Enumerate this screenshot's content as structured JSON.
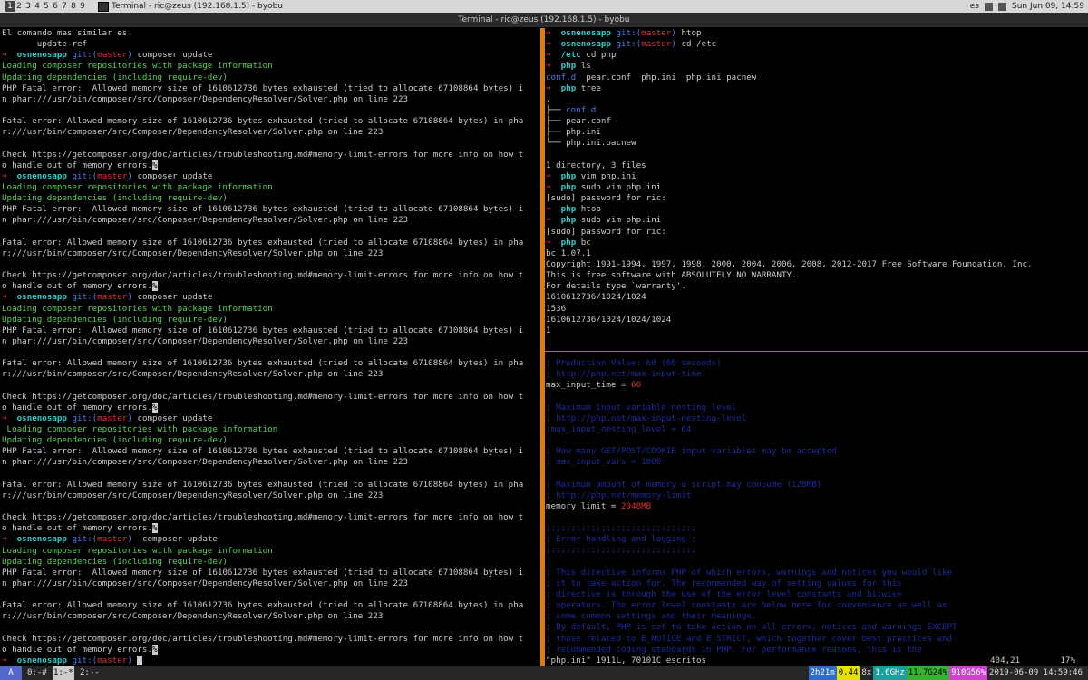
{
  "desktop": {
    "workspaces": [
      "1",
      "2",
      "3",
      "4",
      "5",
      "6",
      "7",
      "8",
      "9"
    ],
    "active_workspace": "1",
    "task_label": "Terminal - ric@zeus (192.168.1.5) - byobu",
    "tray_lang": "es",
    "tray_datetime": "Sun Jun 09, 14:59"
  },
  "window": {
    "title": "Terminal - ric@zeus (192.168.1.5) - byobu"
  },
  "left_pane": {
    "lines": [
      "El comando mas similar es",
      "       update-ref",
      "➜  osnenosapp git:(master) composer update",
      "Loading composer repositories with package information",
      "Updating dependencies (including require-dev)",
      "PHP Fatal error:  Allowed memory size of 1610612736 bytes exhausted (tried to allocate 67108864 bytes) i",
      "n phar:///usr/bin/composer/src/Composer/DependencyResolver/Solver.php on line 223",
      "",
      "Fatal error: Allowed memory size of 1610612736 bytes exhausted (tried to allocate 67108864 bytes) in pha",
      "r:///usr/bin/composer/src/Composer/DependencyResolver/Solver.php on line 223",
      "",
      "Check https://getcomposer.org/doc/articles/troubleshooting.md#memory-limit-errors for more info on how t",
      "o handle out of memory errors.%",
      "➜  osnenosapp git:(master) composer update",
      "Loading composer repositories with package information",
      "Updating dependencies (including require-dev)",
      "PHP Fatal error:  Allowed memory size of 1610612736 bytes exhausted (tried to allocate 67108864 bytes) i",
      "n phar:///usr/bin/composer/src/Composer/DependencyResolver/Solver.php on line 223",
      "",
      "Fatal error: Allowed memory size of 1610612736 bytes exhausted (tried to allocate 67108864 bytes) in pha",
      "r:///usr/bin/composer/src/Composer/DependencyResolver/Solver.php on line 223",
      "",
      "Check https://getcomposer.org/doc/articles/troubleshooting.md#memory-limit-errors for more info on how t",
      "o handle out of memory errors.%",
      "➜  osnenosapp git:(master) composer update",
      "Loading composer repositories with package information",
      "Updating dependencies (including require-dev)",
      "PHP Fatal error:  Allowed memory size of 1610612736 bytes exhausted (tried to allocate 67108864 bytes) i",
      "n phar:///usr/bin/composer/src/Composer/DependencyResolver/Solver.php on line 223",
      "",
      "Fatal error: Allowed memory size of 1610612736 bytes exhausted (tried to allocate 67108864 bytes) in pha",
      "r:///usr/bin/composer/src/Composer/DependencyResolver/Solver.php on line 223",
      "",
      "Check https://getcomposer.org/doc/articles/troubleshooting.md#memory-limit-errors for more info on how t",
      "o handle out of memory errors.%",
      "➜  osnenosapp git:(master) composer update",
      " Loading composer repositories with package information",
      "Updating dependencies (including require-dev)",
      "PHP Fatal error:  Allowed memory size of 1610612736 bytes exhausted (tried to allocate 67108864 bytes) i",
      "n phar:///usr/bin/composer/src/Composer/DependencyResolver/Solver.php on line 223",
      "",
      "Fatal error: Allowed memory size of 1610612736 bytes exhausted (tried to allocate 67108864 bytes) in pha",
      "r:///usr/bin/composer/src/Composer/DependencyResolver/Solver.php on line 223",
      "",
      "Check https://getcomposer.org/doc/articles/troubleshooting.md#memory-limit-errors for more info on how t",
      "o handle out of memory errors.%",
      "➜  osnenosapp git:(master)  composer update",
      "Loading composer repositories with package information",
      "Updating dependencies (including require-dev)",
      "PHP Fatal error:  Allowed memory size of 1610612736 bytes exhausted (tried to allocate 67108864 bytes) i",
      "n phar:///usr/bin/composer/src/Composer/DependencyResolver/Solver.php on line 223",
      "",
      "Fatal error: Allowed memory size of 1610612736 bytes exhausted (tried to allocate 67108864 bytes) in pha",
      "r:///usr/bin/composer/src/Composer/DependencyResolver/Solver.php on line 223",
      "",
      "Check https://getcomposer.org/doc/articles/troubleshooting.md#memory-limit-errors for more info on how t",
      "o handle out of memory errors.%",
      "➜  osnenosapp git:(master) "
    ]
  },
  "right_pane": {
    "lines": [
      "➜  osnenosapp git:(master) htop",
      "➜  osnenosapp git:(master) cd /etc",
      "➜  /etc cd php",
      "➜  php ls",
      "conf.d  pear.conf  php.ini  php.ini.pacnew",
      "➜  php tree",
      ".",
      "├── conf.d",
      "├── pear.conf",
      "├── php.ini",
      "└── php.ini.pacnew",
      "",
      "1 directory, 3 files",
      "➜  php vim php.ini",
      "➜  php sudo vim php.ini",
      "[sudo] password for ric:",
      "➜  php htop",
      "➜  php sudo vim php.ini",
      "[sudo] password for ric:",
      "➜  php bc",
      "bc 1.07.1",
      "Copyright 1991-1994, 1997, 1998, 2000, 2004, 2006, 2008, 2012-2017 Free Software Foundation, Inc.",
      "This is free software with ABSOLUTELY NO WARRANTY.",
      "For details type `warranty'.",
      "1610612736/1024/1024",
      "1536",
      "1610612736/1024/1024/1024",
      "1"
    ]
  },
  "vim_pane": {
    "lines": [
      "; Production Value: 60 (60 seconds)",
      "; http://php.net/max-input-time",
      "max_input_time = 60",
      "",
      "; Maximum input variable nesting level",
      "; http://php.net/max-input-nesting-level",
      ";max_input_nesting_level = 64",
      "",
      "; How many GET/POST/COOKIE input variables may be accepted",
      "; max_input_vars = 1000",
      "",
      "; Maximum amount of memory a script may consume (128MB)",
      "; http://php.net/memory-limit",
      "memory_limit = 2048MB",
      "",
      ";;;;;;;;;;;;;;;;;;;;;;;;;;;;;;",
      "; Error handling and logging ;",
      ";;;;;;;;;;;;;;;;;;;;;;;;;;;;;;",
      "",
      "; This directive informs PHP of which errors, warnings and notices you would like",
      "; it to take action for. The recommended way of setting values for this",
      "; directive is through the use of the error level constants and bitwise",
      "; operators. The error level constants are below here for convenience as well as",
      "; some common settings and their meanings.",
      "; By default, PHP is set to take action on all errors, notices and warnings EXCEPT",
      "; those related to E_NOTICE and E_STRICT, which together cover best practices and",
      "; recommended coding standards in PHP. For performance reasons, this is the"
    ],
    "status_file": "\"php.ini\" 1911L, 70101C escritos",
    "status_pos": "404,21",
    "status_pct": "17%"
  },
  "byobu_status": {
    "left_badge": "A",
    "windows": [
      "0:-#",
      "1:-*",
      "2:--"
    ],
    "uptime": "2h21m",
    "load": "0.44",
    "cpu": "8x",
    "freq": "1.6GHz",
    "mem": "11.7G24%",
    "disk": "910G56%",
    "datetime": "2019-06-09 14:59:46"
  },
  "colors": {
    "divider": "#e07a12",
    "prompt_arrow": "#dd3333",
    "prompt_dir": "#33cccc",
    "git_label": "#4a7df0",
    "green_output": "#5ad15a",
    "vim_comment": "#1d2b9e"
  }
}
